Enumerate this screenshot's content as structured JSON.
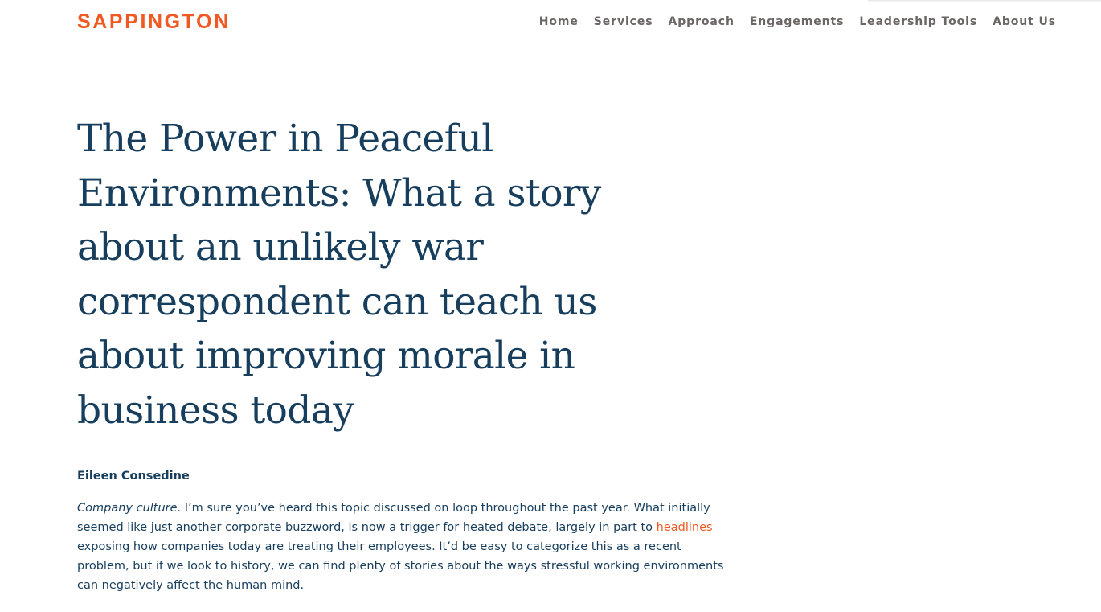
{
  "header": {
    "logo": "SAPPINGTON",
    "nav": [
      {
        "label": "Home"
      },
      {
        "label": "Services"
      },
      {
        "label": "Approach"
      },
      {
        "label": "Engagements"
      },
      {
        "label": "Leadership Tools"
      },
      {
        "label": "About Us"
      }
    ]
  },
  "article": {
    "title": "The Power in Peaceful Environments: What a story about an unlikely war correspondent can teach us about improving morale in business today",
    "author": "Eileen Consedine",
    "intro": {
      "emphasis": "Company culture",
      "text_after_emphasis": ". I’m sure you’ve heard this topic discussed on loop throughout the past year. What initially seemed like just another corporate buzzword, is now a trigger for heated debate, largely in part to ",
      "link_text": "headlines",
      "text_after_link": " exposing how companies today are treating their employees. It’d be easy to categorize this as a recent problem, but if we look to history, we can find plenty of stories about the ways stressful working environments can negatively affect the human mind."
    }
  },
  "colors": {
    "brand_orange": "#f05a22",
    "heading_navy": "#173e5c",
    "nav_gray": "#6b6664"
  }
}
